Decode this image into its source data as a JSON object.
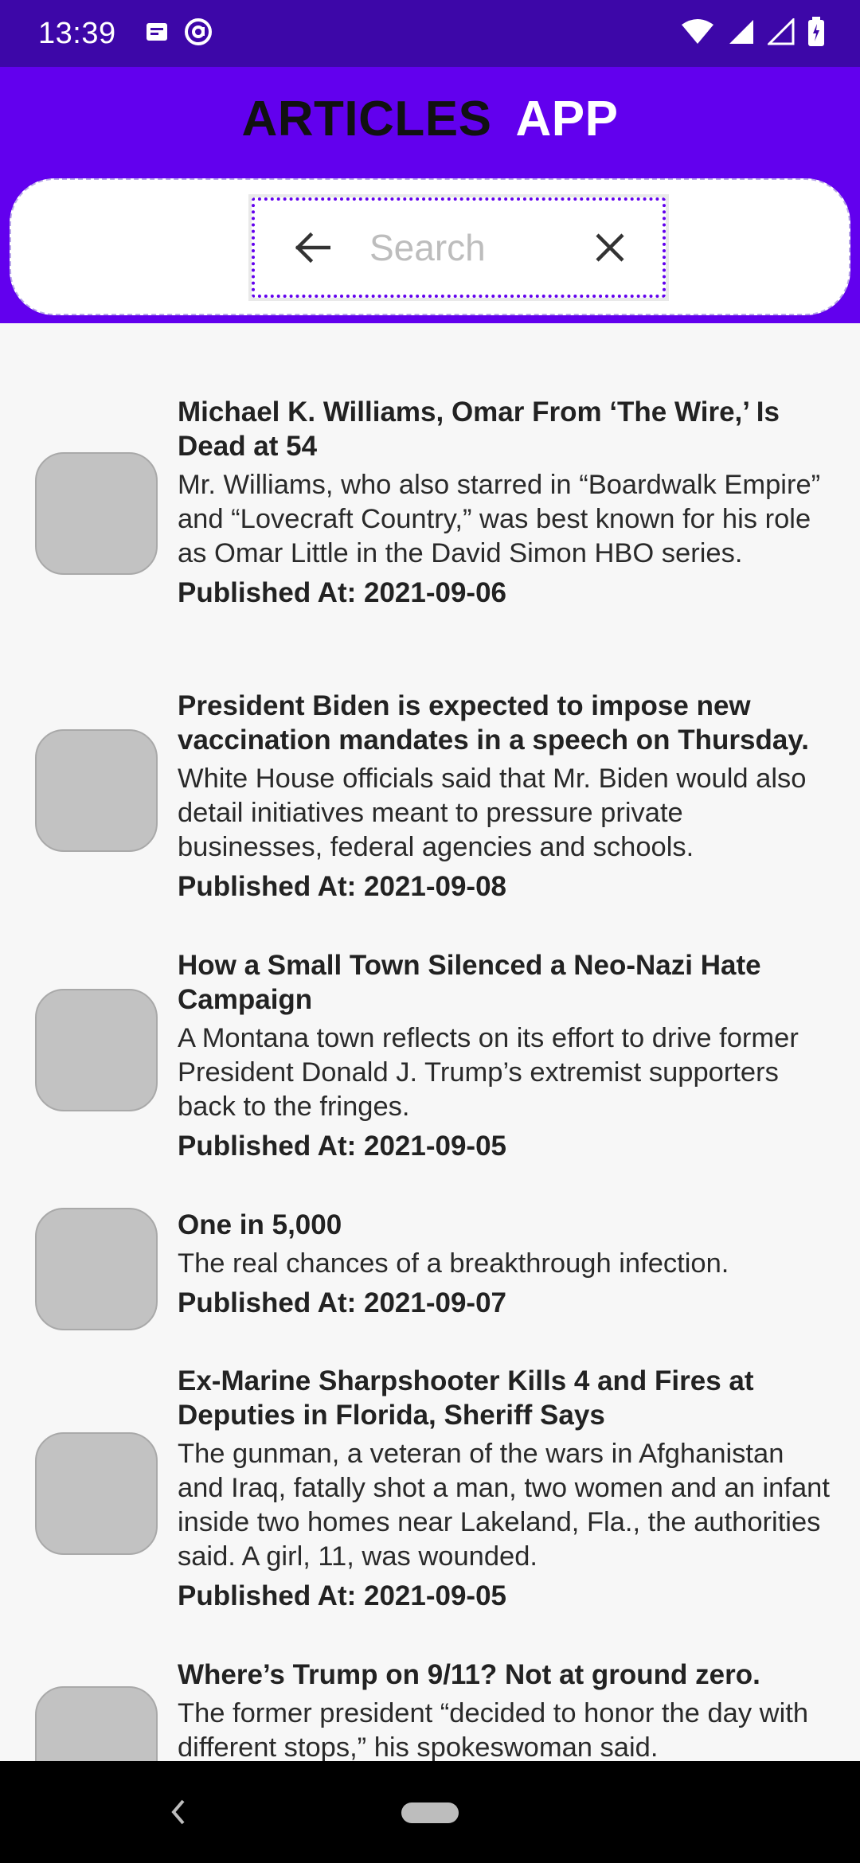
{
  "status": {
    "time": "13:39",
    "icons_left": [
      "sim-card-icon",
      "at-sign-icon"
    ],
    "icons_right": [
      "wifi-icon",
      "signal-icon",
      "signal-icon",
      "battery-icon"
    ]
  },
  "app": {
    "title_part1": "ARTICLES",
    "title_part2": "APP",
    "title_part1_color": "#111111",
    "title_part2_color": "#ffffff",
    "bar_color": "#6200ee",
    "status_bar_color": "#3d07a8"
  },
  "search": {
    "placeholder": "Search",
    "value": "",
    "back_icon": "arrow-left-icon",
    "clear_icon": "close-icon"
  },
  "articles": [
    {
      "title": "Michael K. Williams, Omar From ‘The Wire,’ Is Dead at 54",
      "description": "Mr. Williams, who also starred in “Boardwalk Empire” and “Lovecraft Country,” was best known for his role as Omar Little in the David Simon HBO series.",
      "published": "Published At: 2021-09-06"
    },
    {
      "title": "President Biden is expected to impose new vaccination mandates in a speech on Thursday.",
      "description": "White House officials said that Mr. Biden would also detail initiatives meant to pressure private businesses, federal agencies and schools.",
      "published": "Published At: 2021-09-08"
    },
    {
      "title": "How a Small Town Silenced a Neo-Nazi Hate Campaign",
      "description": "A Montana town reflects on its effort to drive former President Donald J. Trump’s extremist supporters back to the fringes.",
      "published": "Published At: 2021-09-05"
    },
    {
      "title": "One in 5,000",
      "description": "The real chances of a breakthrough infection.",
      "published": "Published At: 2021-09-07"
    },
    {
      "title": "Ex-Marine Sharpshooter Kills 4 and Fires at Deputies in Florida, Sheriff Says",
      "description": "The gunman, a veteran of the wars in Afghanistan and Iraq, fatally shot a man, two women and an infant inside two homes near Lakeland, Fla., the authorities said. A girl, 11, was wounded.",
      "published": "Published At: 2021-09-05"
    },
    {
      "title": "Where’s Trump on 9/11? Not at ground zero.",
      "description": "The former president “decided to honor the day with different stops,” his spokeswoman said.",
      "published": ""
    }
  ],
  "nav": {
    "back_icon": "nav-back-icon",
    "home_icon": "nav-home-pill-icon"
  }
}
